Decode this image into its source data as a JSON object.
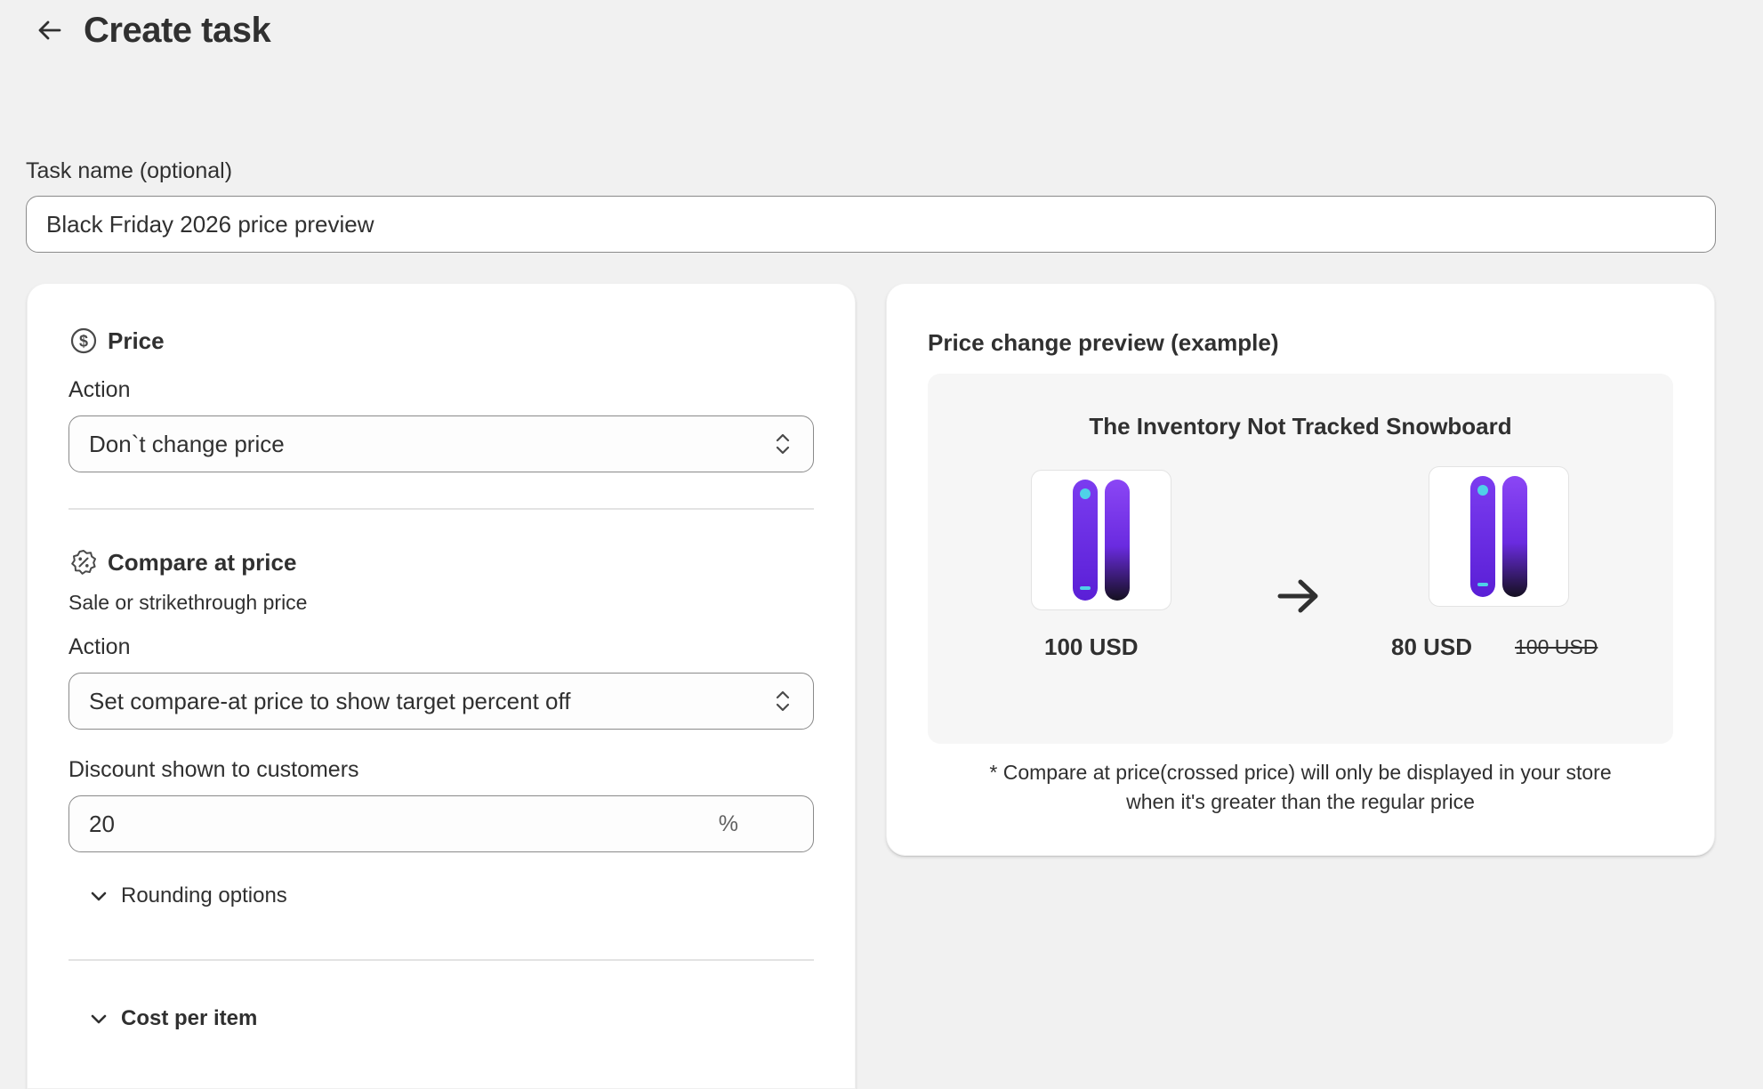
{
  "header": {
    "title": "Create task",
    "back_icon": "arrow-left-icon"
  },
  "task_name": {
    "label": "Task name (optional)",
    "value": "Black Friday 2026 price preview"
  },
  "price_section": {
    "icon": "dollar-circle-icon",
    "title": "Price",
    "action_label": "Action",
    "action_value": "Don`t change price"
  },
  "compare_section": {
    "icon": "discount-badge-icon",
    "title": "Compare at price",
    "subtitle": "Sale or strikethrough price",
    "action_label": "Action",
    "action_value": "Set compare-at price to show target percent off",
    "discount_label": "Discount shown to customers",
    "discount_value": "20",
    "discount_suffix": "%",
    "rounding_label": "Rounding options"
  },
  "cost_section": {
    "label": "Cost per item"
  },
  "preview": {
    "title": "Price change preview (example)",
    "product_name": "The Inventory Not Tracked Snowboard",
    "before_price": "100 USD",
    "after_price": "80 USD",
    "compare_price": "100 USD",
    "note_line1": "* Compare at price(crossed price) will only be displayed in your store",
    "note_line2": "when it's greater than the regular price"
  },
  "colors": {
    "page_bg": "#f1f1f1",
    "card_bg": "#ffffff",
    "board_purple": "#6a2be0",
    "text": "#303030"
  }
}
